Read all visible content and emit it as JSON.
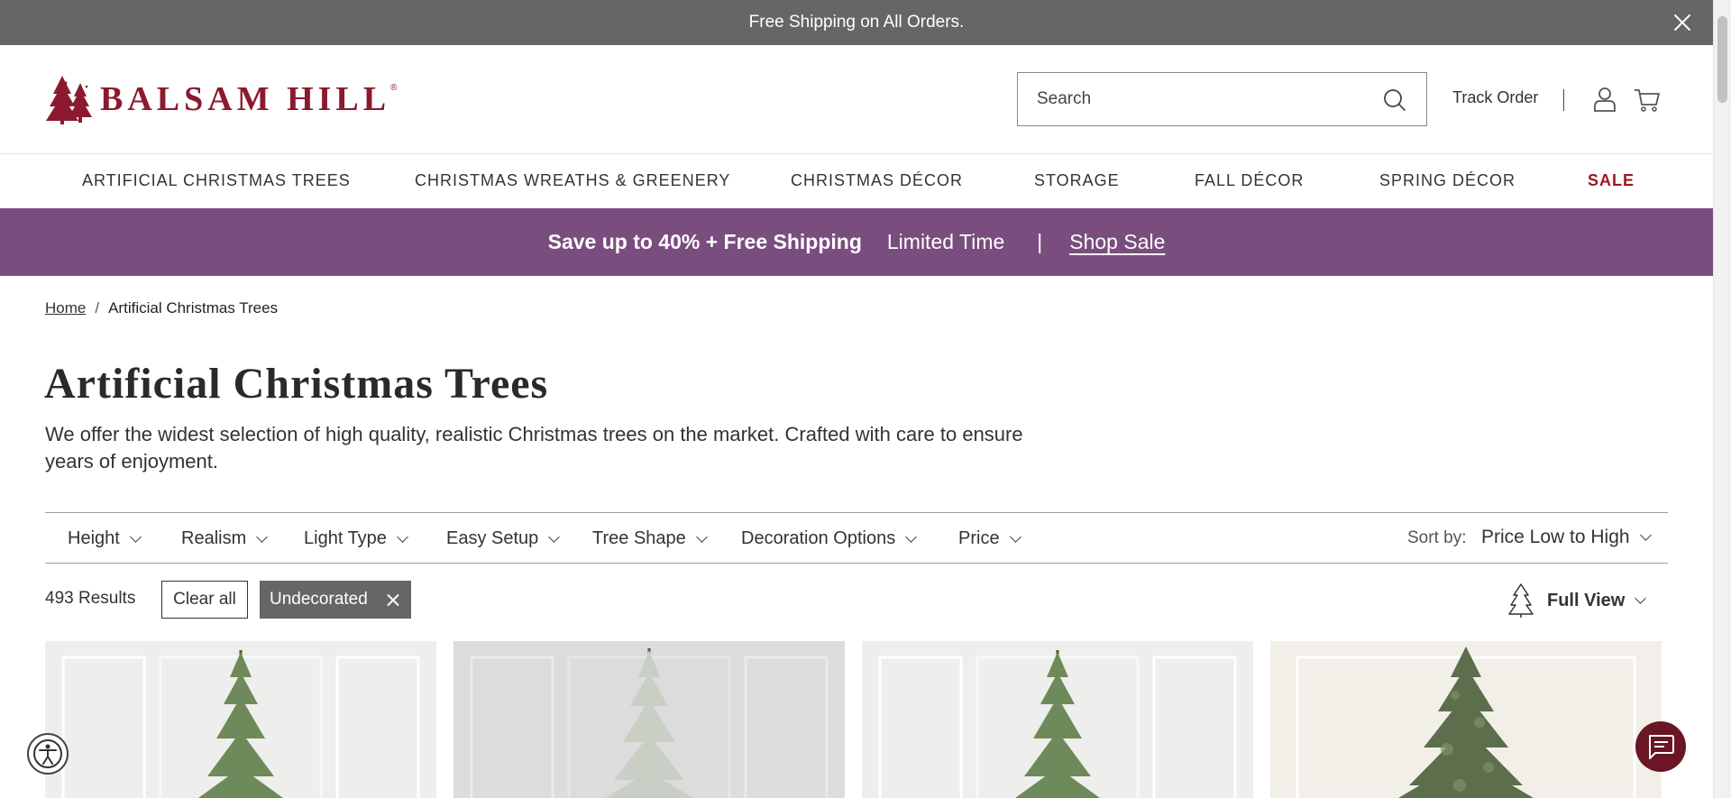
{
  "announcement": {
    "text": "Free Shipping on All Orders."
  },
  "header": {
    "logo_text": "BALSAM HILL",
    "logo_reg": "®",
    "search_placeholder": "Search",
    "track_order": "Track Order"
  },
  "nav": {
    "items": [
      {
        "label": "ARTIFICIAL CHRISTMAS TREES"
      },
      {
        "label": "CHRISTMAS WREATHS & GREENERY"
      },
      {
        "label": "CHRISTMAS DÉCOR"
      },
      {
        "label": "STORAGE"
      },
      {
        "label": "FALL DÉCOR"
      },
      {
        "label": "SPRING DÉCOR"
      },
      {
        "label": "SALE"
      }
    ],
    "sale_color": "#a01622"
  },
  "promo": {
    "headline": "Save up to 40% + Free Shipping",
    "limited": "Limited Time",
    "separator": "|",
    "link": "Shop Sale",
    "background": "#7a4d7f"
  },
  "breadcrumb": {
    "home": "Home",
    "separator": "/",
    "current": "Artificial Christmas Trees"
  },
  "page": {
    "title": "Artificial Christmas Trees",
    "description": "We offer the widest selection of high quality, realistic Christmas trees on the market. Crafted with care to ensure years of enjoyment."
  },
  "filters": {
    "items": [
      {
        "label": "Height"
      },
      {
        "label": "Realism"
      },
      {
        "label": "Light Type"
      },
      {
        "label": "Easy Setup"
      },
      {
        "label": "Tree Shape"
      },
      {
        "label": "Decoration Options"
      },
      {
        "label": "Price"
      }
    ],
    "sort_label": "Sort by:",
    "sort_value": "Price Low to High"
  },
  "results": {
    "count": "493 Results",
    "clear_all": "Clear all",
    "active_chip": "Undecorated",
    "view_label": "Full View"
  },
  "products": [
    {
      "image": "sparse-green-tree"
    },
    {
      "image": "frosted-sparse-tree"
    },
    {
      "image": "sparse-green-tree"
    },
    {
      "image": "full-green-tree"
    }
  ],
  "brand_color": "#8b1a2e"
}
